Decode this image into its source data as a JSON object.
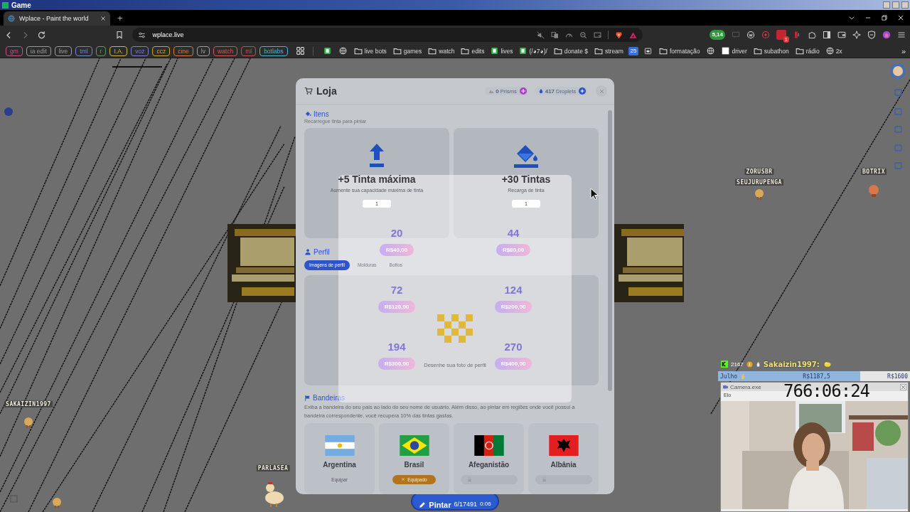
{
  "window": {
    "title": "Game"
  },
  "browser": {
    "tabs": [
      {
        "label": "Wplace - Paint the world",
        "selected": true
      }
    ],
    "new_tab": "+",
    "url": "wplace.live",
    "extension_badges": [
      "5,14",
      "1"
    ],
    "bookmarks": [
      {
        "kind": "tag",
        "label": "gm",
        "color": "#c94f86"
      },
      {
        "kind": "tag",
        "label": "ia edit",
        "color": "#9a9a9a"
      },
      {
        "kind": "tag",
        "label": "live",
        "color": "#9a9a9a"
      },
      {
        "kind": "tag",
        "label": "tml",
        "color": "#6f86c9"
      },
      {
        "kind": "tag",
        "label": "r",
        "color": "#5f9a62"
      },
      {
        "kind": "tag",
        "label": "I.A.",
        "color": "#c9b54f"
      },
      {
        "kind": "tag",
        "label": "voz",
        "color": "#7b7fcf"
      },
      {
        "kind": "tag",
        "label": "ccz",
        "color": "#d1a23c"
      },
      {
        "kind": "tag",
        "label": "cine",
        "color": "#d07a45"
      },
      {
        "kind": "tag",
        "label": "lv",
        "color": "#a0a0a0"
      },
      {
        "kind": "tag",
        "label": "watch",
        "color": "#d0555a"
      },
      {
        "kind": "tag",
        "label": "ml",
        "color": "#c0504d"
      },
      {
        "kind": "tag",
        "label": "botlabs",
        "color": "#4fb2c9"
      },
      {
        "kind": "apps"
      },
      {
        "kind": "app"
      },
      {
        "kind": "globe"
      },
      {
        "kind": "folder",
        "label": "live bots"
      },
      {
        "kind": "folder",
        "label": "games"
      },
      {
        "kind": "folder",
        "label": "watch"
      },
      {
        "kind": "folder",
        "label": "edits"
      },
      {
        "kind": "app",
        "label": "lives"
      },
      {
        "kind": "app",
        "label": "(/◕7◕)/"
      },
      {
        "kind": "folder",
        "label": "donate $"
      },
      {
        "kind": "folder",
        "label": "stream"
      },
      {
        "kind": "calendar",
        "label": "25"
      },
      {
        "kind": "widget"
      },
      {
        "kind": "folder",
        "label": "formatação"
      },
      {
        "kind": "globe"
      },
      {
        "kind": "page",
        "label": "driver"
      },
      {
        "kind": "folder",
        "label": "subathon"
      },
      {
        "kind": "folder",
        "label": "rádio"
      },
      {
        "kind": "globe",
        "label": "2x"
      },
      {
        "kind": "more",
        "label": "»"
      }
    ]
  },
  "canvas": {
    "players": [
      {
        "name": "ZORUSBR"
      },
      {
        "name": "SEUJURUPENGA"
      },
      {
        "name": "BOTRIX"
      },
      {
        "name": "SAKAIZIN1997"
      },
      {
        "name": "PARLASEA"
      }
    ]
  },
  "shop": {
    "title": "Loja",
    "balances": [
      {
        "amount": "0",
        "unit": "Prisms"
      },
      {
        "amount": "417",
        "unit": "Droplets"
      }
    ],
    "items_section": {
      "title": "Itens",
      "subtitle": "Recarregue tinta para pintar",
      "items": [
        {
          "kind": "max",
          "title": "+5 Tinta máxima",
          "description": "Aumente sua capacidade máxima de tinta",
          "quantity": "1"
        },
        {
          "kind": "refill",
          "title": "+30 Tintas",
          "description": "Recarga de tinta",
          "quantity": "1"
        }
      ]
    },
    "profile_section": {
      "title": "Perfil",
      "tabs": [
        {
          "label": "Imagens de perfil",
          "selected": true
        },
        {
          "label": "Molduras",
          "selected": false
        },
        {
          "label": "Bottos",
          "selected": false
        }
      ]
    },
    "flags_section": {
      "title": "Bandeiras",
      "description": "Exiba a bandeira do seu país ao lado do seu nome de usuário. Além disso, ao pintar em regiões onde você possui a bandeira correspondente, você recupera 10% das tintas gastas.",
      "flags": [
        {
          "kind": "argentina",
          "name": "Argentina",
          "locked": false,
          "equipped": false,
          "button": "Equipar"
        },
        {
          "kind": "brazil",
          "name": "Brasil",
          "locked": false,
          "equipped": true,
          "button": "Equipado"
        },
        {
          "kind": "afghanistan",
          "name": "Afeganistão",
          "locked": true
        },
        {
          "kind": "albania",
          "name": "Albânia",
          "locked": true
        }
      ]
    }
  },
  "popup": {
    "packs": [
      {
        "amount": "20",
        "price": "R$40,00"
      },
      {
        "amount": "44",
        "price": "R$80,00"
      },
      {
        "amount": "72",
        "price": "R$120,00"
      },
      {
        "amount": "124",
        "price": "R$200,00"
      },
      {
        "amount": "194",
        "price": "R$300,00"
      },
      {
        "amount": "270",
        "price": "R$400,00"
      }
    ],
    "caption": "Desenhe sua foto de perfil"
  },
  "paint_button": {
    "label": "Pintar",
    "count": "6/17491",
    "timer": "0:06"
  },
  "stream": {
    "chat": {
      "points": "2167",
      "user": "Sakaizin1997:"
    },
    "goal": {
      "label": "Julho",
      "current": "R$1187,5",
      "target": "R$1600",
      "level": 0.74
    },
    "camera": {
      "title": "Camera.exe",
      "timer": "766:06:24",
      "menu": "Elo"
    }
  }
}
